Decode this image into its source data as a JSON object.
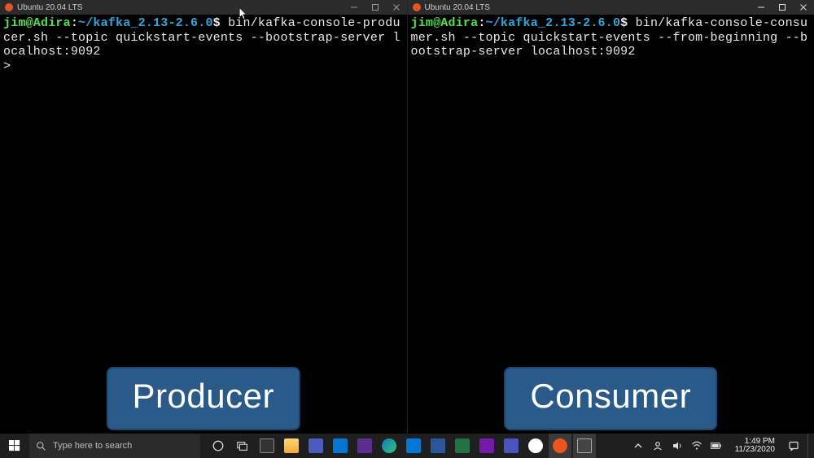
{
  "windows": [
    {
      "title": "Ubuntu 20.04 LTS",
      "prompt_user": "jim@Adira",
      "prompt_sep1": ":",
      "prompt_path": "~/kafka_2.13-2.6.0",
      "prompt_sep2": "$ ",
      "command": "bin/kafka-console-producer.sh --topic quickstart-events --bootstrap-server localhost:9092",
      "next_line": ">",
      "overlay": "Producer"
    },
    {
      "title": "Ubuntu 20.04 LTS",
      "prompt_user": "jim@Adira",
      "prompt_sep1": ":",
      "prompt_path": "~/kafka_2.13-2.6.0",
      "prompt_sep2": "$ ",
      "command": "bin/kafka-console-consumer.sh --topic quickstart-events --from-beginning --bootstrap-server localhost:9092",
      "next_line": "",
      "overlay": "Consumer"
    }
  ],
  "taskbar": {
    "search_placeholder": "Type here to search",
    "time": "1:49 PM",
    "date": "11/23/2020"
  },
  "colors": {
    "ubuntu_orange": "#e95420",
    "overlay_blue": "#2a5a8a"
  }
}
